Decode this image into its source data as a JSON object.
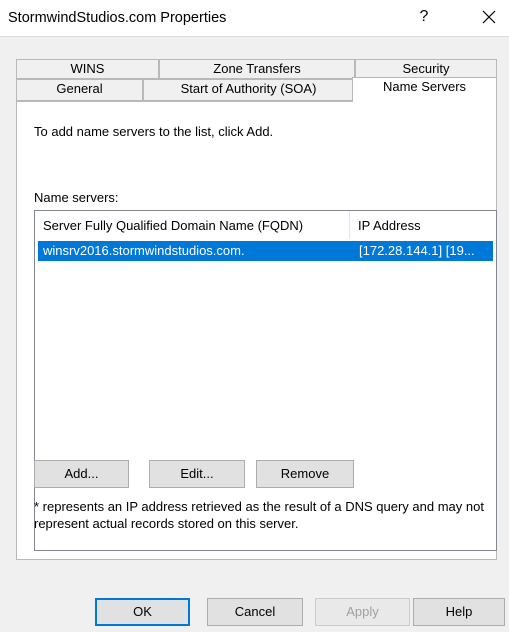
{
  "window": {
    "title": "StormwindStudios.com Properties",
    "help_label": "?"
  },
  "tabs": {
    "row_top": [
      {
        "label": "WINS"
      },
      {
        "label": "Zone Transfers"
      },
      {
        "label": "Security"
      }
    ],
    "row_bottom": [
      {
        "label": "General"
      },
      {
        "label": "Start of Authority (SOA)"
      },
      {
        "label": "Name Servers",
        "active": true
      }
    ]
  },
  "panel": {
    "instruction": "To add name servers to the list, click Add.",
    "list_label": "Name servers:",
    "list": {
      "columns": [
        "Server Fully Qualified Domain Name (FQDN)",
        "IP Address"
      ],
      "rows": [
        {
          "fqdn": "winsrv2016.stormwindstudios.com.",
          "ip": "[172.28.144.1] [19...",
          "selected": true
        }
      ]
    },
    "buttons": {
      "add": "Add...",
      "edit": "Edit...",
      "remove": "Remove"
    },
    "note": "* represents an IP address retrieved as the result of a DNS query and may not represent actual records stored on this server."
  },
  "footer": {
    "ok": "OK",
    "cancel": "Cancel",
    "apply": "Apply",
    "help": "Help"
  },
  "colors": {
    "selection": "#0078d7",
    "default_button_border": "#0078d7"
  }
}
